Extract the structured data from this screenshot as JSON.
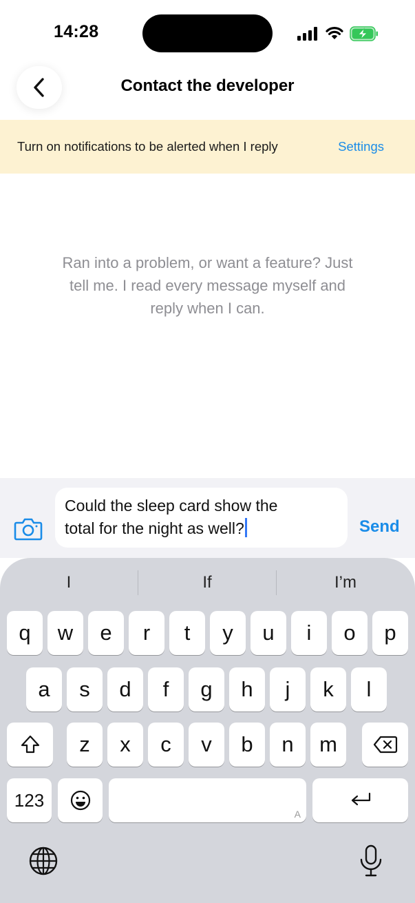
{
  "status_bar": {
    "time": "14:28"
  },
  "nav": {
    "title": "Contact the developer",
    "back_icon": "chevron-left-icon"
  },
  "banner": {
    "text": "Turn on notifications to be alerted when I reply",
    "link_label": "Settings",
    "background": "#fdf2d2",
    "link_color": "#1a8ce8"
  },
  "empty_state": {
    "line1": "Ran into a problem, or want a feature? Just",
    "line2": "tell me. I read every message myself and",
    "line3": "reply when I can."
  },
  "composer": {
    "line1": "Could the sleep card show the",
    "line2": "total for the night as well?",
    "send_label": "Send",
    "camera_icon": "camera-icon"
  },
  "keyboard": {
    "suggestions": [
      "I",
      "If",
      "I’m"
    ],
    "row1": [
      "q",
      "w",
      "e",
      "r",
      "t",
      "y",
      "u",
      "i",
      "o",
      "p"
    ],
    "row2": [
      "a",
      "s",
      "d",
      "f",
      "g",
      "h",
      "j",
      "k",
      "l"
    ],
    "row3": [
      "z",
      "x",
      "c",
      "v",
      "b",
      "n",
      "m"
    ],
    "numbers_label": "123",
    "space_hint": "A",
    "icons": [
      "shift-icon",
      "backspace-icon",
      "emoji-icon",
      "return-icon",
      "globe-icon",
      "microphone-icon"
    ]
  },
  "colors": {
    "accent": "#1a8ce8",
    "battery": "#34c759"
  }
}
